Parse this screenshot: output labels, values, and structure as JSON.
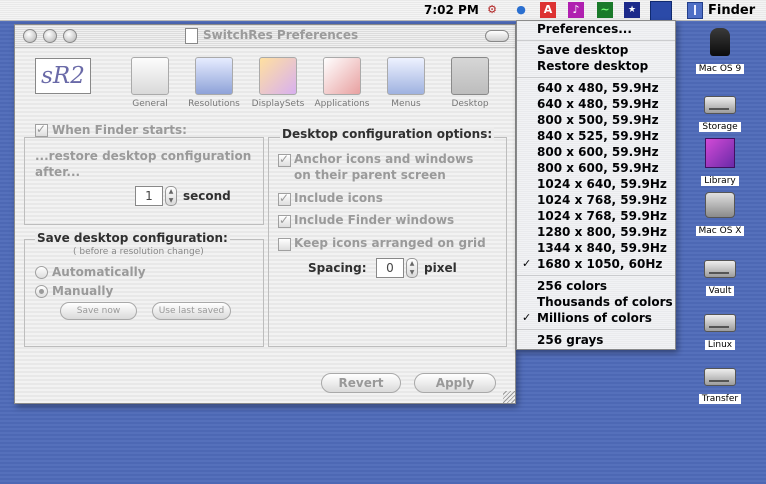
{
  "menubar": {
    "clock": "7:02 PM",
    "app_menu_label": "Finder"
  },
  "window": {
    "title": "SwitchRes Preferences",
    "logo_text": "sR2",
    "toolbar": [
      "General",
      "Resolutions",
      "DisplaySets",
      "Applications",
      "Menus",
      "Desktop"
    ],
    "when_finder_starts": {
      "label": "When Finder starts:",
      "checked": true,
      "description": "...restore desktop configuration after...",
      "line1": "...restore desktop configuration",
      "line2": "after...",
      "seconds_value": "1",
      "seconds_unit": "second"
    },
    "save_config": {
      "heading": "Save desktop configuration:",
      "subheading": "( before a resolution change)",
      "options": [
        "Automatically",
        "Manually"
      ],
      "selected": "Manually",
      "save_now": "Save now",
      "use_last_saved": "Use last saved"
    },
    "desktop_options": {
      "heading": "Desktop configuration options:",
      "anchor_line1": "Anchor icons and windows",
      "anchor_line2": "on their parent screen",
      "include_icons": "Include icons",
      "include_finder_windows": "Include Finder windows",
      "keep_grid": "Keep icons arranged on grid",
      "spacing_label": "Spacing:",
      "spacing_value": "0",
      "spacing_unit": "pixel"
    },
    "revert": "Revert",
    "apply": "Apply"
  },
  "menu": {
    "preferences": "Preferences...",
    "save_desktop": "Save desktop",
    "restore_desktop": "Restore desktop",
    "resolutions": [
      "640 x 480, 59.9Hz",
      "640 x 480, 59.9Hz",
      "800 x 500, 59.9Hz",
      "840 x 525, 59.9Hz",
      "800 x 600, 59.9Hz",
      "800 x 600, 59.9Hz",
      "1024 x 640, 59.9Hz",
      "1024 x 768, 59.9Hz",
      "1024 x 768, 59.9Hz",
      "1280 x 800, 59.9Hz",
      "1344 x 840, 59.9Hz",
      "1680 x 1050, 60Hz"
    ],
    "colors": [
      "256 colors",
      "Thousands of colors",
      "Millions of colors"
    ],
    "grays": "256 grays",
    "checkmark": "✓"
  },
  "desktop_icons": [
    "Mac OS 9",
    "Storage",
    "Library",
    "Mac OS X",
    "Vault",
    "Linux",
    "Transfer"
  ]
}
